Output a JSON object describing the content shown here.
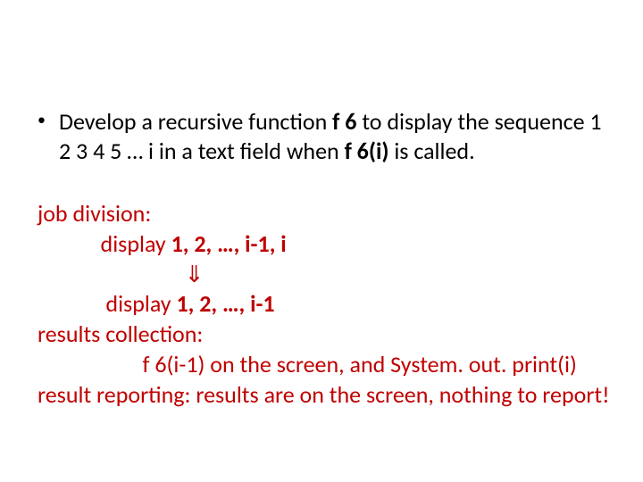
{
  "bullet": {
    "pre": "Develop a recursive function ",
    "fn": "f 6",
    "midA": " to display the sequence 1 2 3 4 5 … i   in a text field when ",
    "call": "f 6(i)",
    "post": " is called."
  },
  "red": {
    "l1": "job division:",
    "l2_pre": "            display ",
    "l2_seq": "1, 2, …, i-1, i",
    "l3": "                            ⇓",
    "l4_pre": "             display ",
    "l4_seq": "1, 2, …, i-1",
    "l5": "results collection:",
    "l6": "                    f 6(i-1) on the screen, and System. out. print(i)",
    "l7": "result reporting: results are on the screen, nothing to report!"
  }
}
